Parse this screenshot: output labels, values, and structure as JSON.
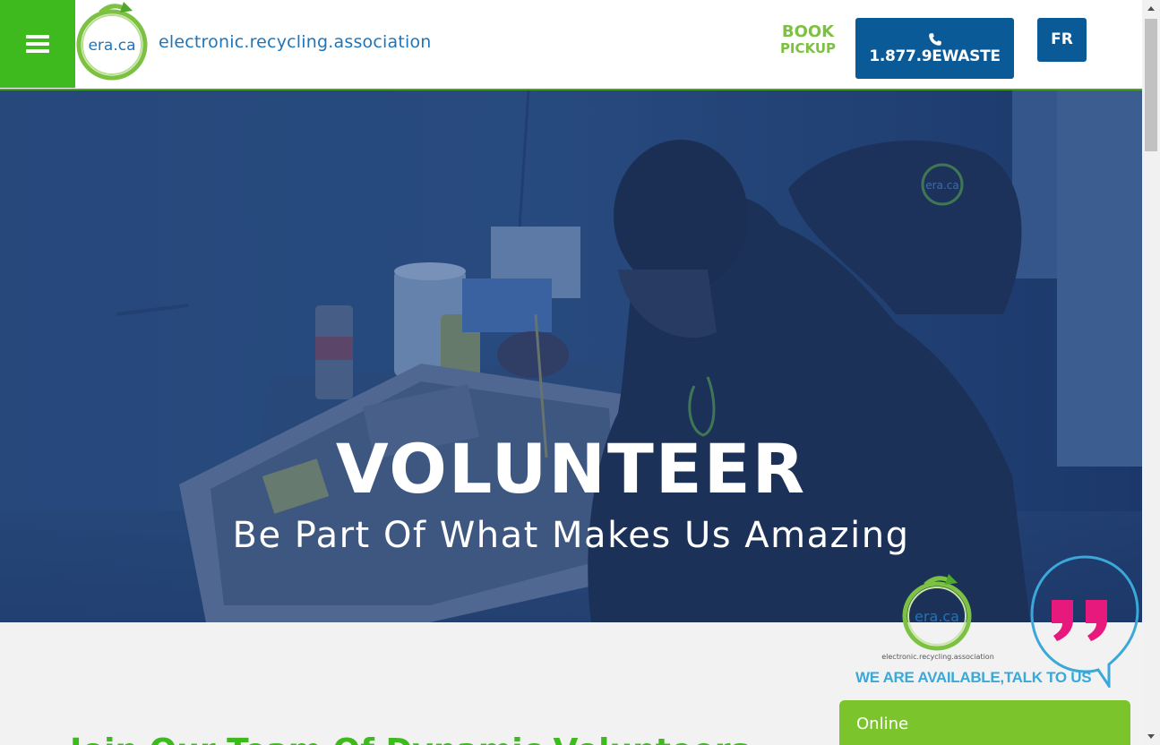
{
  "header": {
    "logo_text": "era.ca",
    "brand": "electronic.recycling.association",
    "book_pickup_line1": "BOOK",
    "book_pickup_line2": "PICKUP",
    "phone": "1.877.9EWASTE",
    "language": "FR"
  },
  "hero": {
    "title": "VOLUNTEER",
    "subtitle": "Be Part Of What Makes Us Amazing",
    "image_logo_text": "era.ca"
  },
  "main": {
    "heading": "Join Our Team Of Dynamic Volunteers"
  },
  "chat": {
    "logo_text": "era.ca",
    "brand_small": "electronic.recycling.association",
    "available_text": "WE ARE AVAILABLE,TALK TO US",
    "status": "Online"
  },
  "colors": {
    "brand_green": "#3eb91e",
    "accent_green": "#7dc142",
    "brand_blue": "#0b5a98",
    "text_blue": "#1f75b8",
    "quote_pink": "#e8197d",
    "bubble_cyan": "#3aa8d8"
  },
  "icons": {
    "menu": "hamburger-icon",
    "phone": "phone-icon",
    "logo": "recycle-arrow-logo",
    "quote": "quote-icon"
  }
}
